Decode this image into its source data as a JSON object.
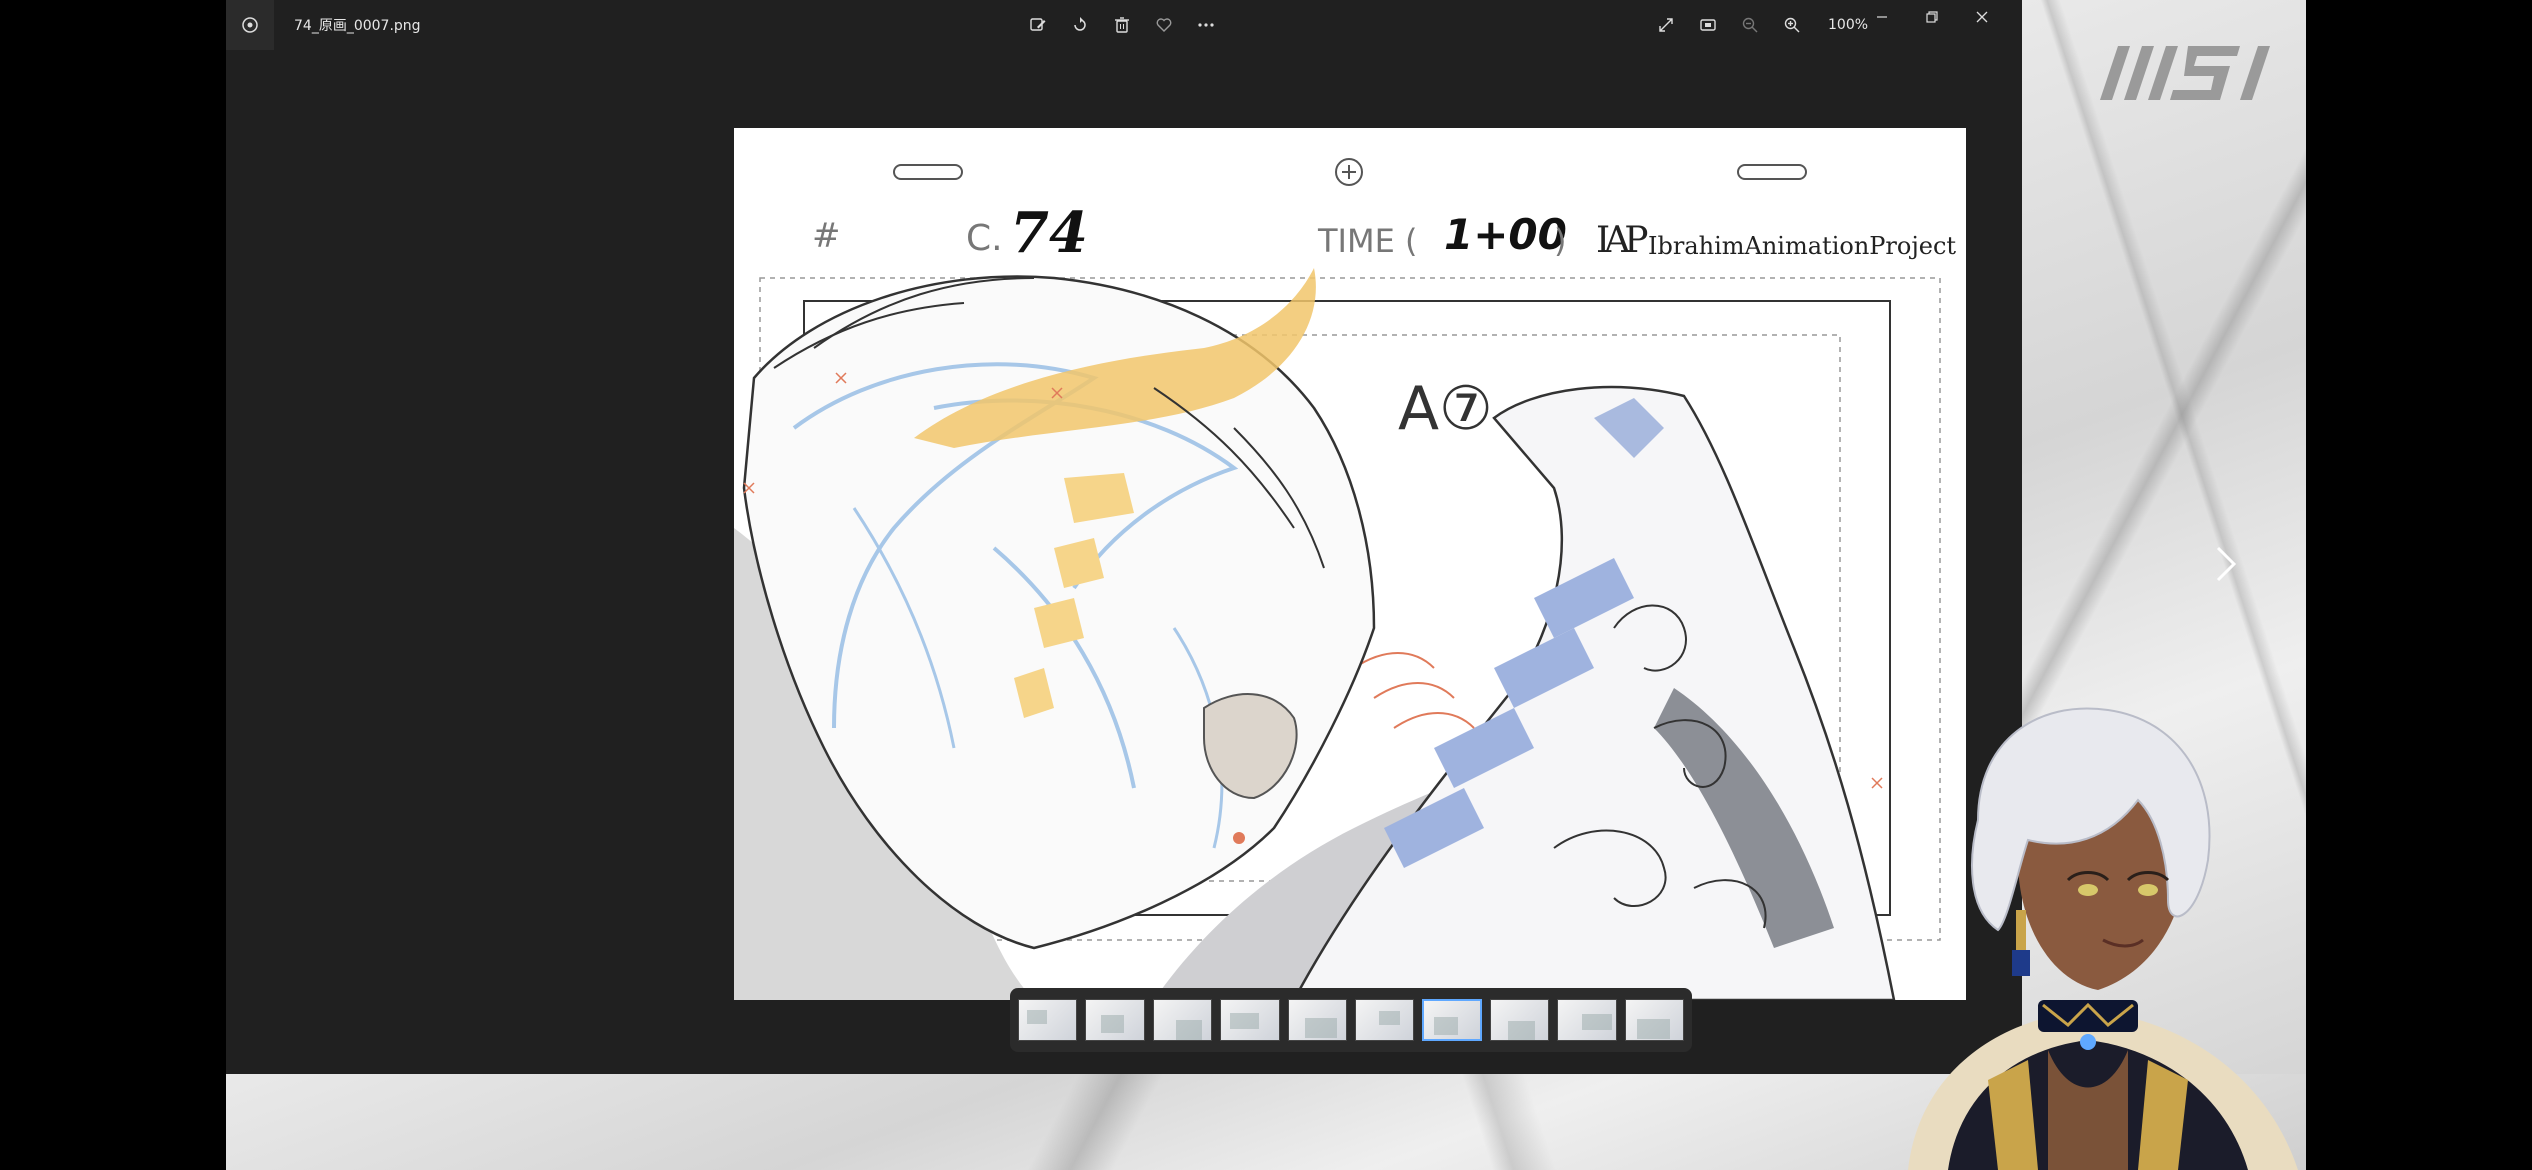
{
  "viewer": {
    "file_name": "74_原画_0007.png",
    "zoom": "100%"
  },
  "sheet": {
    "hash_mark": "#",
    "cut_label": "C.",
    "cut_number": "74",
    "time_label": "TIME (",
    "time_value": "1+00",
    "time_close": ")",
    "studio_logo": "IAP",
    "studio_name": "IbrahimAnimationProject",
    "annotation": "A⑦"
  },
  "filmstrip": {
    "count": 10,
    "selected_index": 6
  },
  "colors": {
    "window_bg": "#202020",
    "titlebar_button": "#2b2b2b",
    "accent": "#5fa8ff",
    "hair_blue": "#a7c7e8",
    "ochre": "#f1c66b",
    "stripe_blue": "#9fb3df"
  },
  "backdrop_logo": "MSI"
}
